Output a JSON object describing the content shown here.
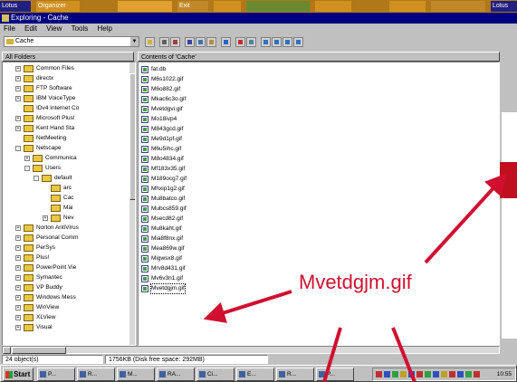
{
  "background_bar": {
    "items": [
      "Lotus",
      "Organizer",
      "",
      "",
      "Exit",
      "",
      "",
      "",
      "",
      "",
      "",
      "Lotus"
    ]
  },
  "window": {
    "title": "Exploring - Cache",
    "menu": [
      "File",
      "Edit",
      "View",
      "Tools",
      "Help"
    ],
    "address": "Cache",
    "all_folders_header": "All Folders",
    "contents_header": "Contents of 'Cache'"
  },
  "tree": [
    {
      "label": "Common Files",
      "indent": 1,
      "expander": "+"
    },
    {
      "label": "directx",
      "indent": 1,
      "expander": "+"
    },
    {
      "label": "FTP Software",
      "indent": 1,
      "expander": "+"
    },
    {
      "label": "IBM VoiceType",
      "indent": 1,
      "expander": "+"
    },
    {
      "label": "IDv4 Internet Co",
      "indent": 1,
      "expander": ""
    },
    {
      "label": "Microsoft Plus!",
      "indent": 1,
      "expander": "+"
    },
    {
      "label": "Kent Hand Sta",
      "indent": 1,
      "expander": "+"
    },
    {
      "label": "NetMeeting",
      "indent": 1,
      "expander": ""
    },
    {
      "label": "Netscape",
      "indent": 1,
      "expander": "-"
    },
    {
      "label": "Communica",
      "indent": 2,
      "expander": "+"
    },
    {
      "label": "Users",
      "indent": 2,
      "expander": "-"
    },
    {
      "label": "default",
      "indent": 3,
      "expander": "-"
    },
    {
      "label": "arc",
      "indent": 4,
      "expander": ""
    },
    {
      "label": "Cac",
      "indent": 4,
      "expander": ""
    },
    {
      "label": "Mai",
      "indent": 4,
      "expander": ""
    },
    {
      "label": "Nev",
      "indent": 4,
      "expander": "+"
    },
    {
      "label": "Norton AntiVirus",
      "indent": 1,
      "expander": "+"
    },
    {
      "label": "Personal Comm",
      "indent": 1,
      "expander": "+"
    },
    {
      "label": "PerSys",
      "indent": 1,
      "expander": "+"
    },
    {
      "label": "Plus!",
      "indent": 1,
      "expander": "+"
    },
    {
      "label": "PowerPoint Vie",
      "indent": 1,
      "expander": "+"
    },
    {
      "label": "Symantec",
      "indent": 1,
      "expander": "+"
    },
    {
      "label": "VP Buddy",
      "indent": 1,
      "expander": "+"
    },
    {
      "label": "Windows Mess",
      "indent": 1,
      "expander": "+"
    },
    {
      "label": "WinView",
      "indent": 1,
      "expander": "+"
    },
    {
      "label": "XLView",
      "indent": 1,
      "expander": "+"
    },
    {
      "label": "Visual",
      "indent": 1,
      "expander": "+"
    }
  ],
  "files": [
    "fat.db",
    "M6s1022.gif",
    "M6o882.gif",
    "Mkac6c3o.gif",
    "Mvetdgvi.gif",
    "Mo18ivp4",
    "M843gcd.gif",
    "Me9d1pf.gif",
    "M6u5ihc.gif",
    "M8o4834.gif",
    "Mf183x35.gif",
    "M189ocg7.gif",
    "Mhxip1g2.gif",
    "Mu8batco.gif",
    "Mubcs859.gif",
    "Msecd82.gif",
    "Mu8kaht.gif",
    "Mia8f8nx.gif",
    "Mea869w.gif",
    "Migwsx8.gif",
    "Mrv8d431.gif",
    "Mv6v3n1.gif",
    "Mvetdgjm.gif"
  ],
  "selected_file": "Mvetdgjm.gif",
  "status": {
    "objects": "24 object(s)",
    "size": "1756KB (Disk free space: 292MB)"
  },
  "taskbar": {
    "start": "Start",
    "tasks": [
      "P...",
      "R...",
      "M...",
      "RA...",
      "Ci...",
      "E...",
      "R...",
      "P..."
    ],
    "clock": "10:55"
  },
  "annotation": {
    "callout": "Mvetdgjm.gif",
    "color": "#d01030"
  }
}
